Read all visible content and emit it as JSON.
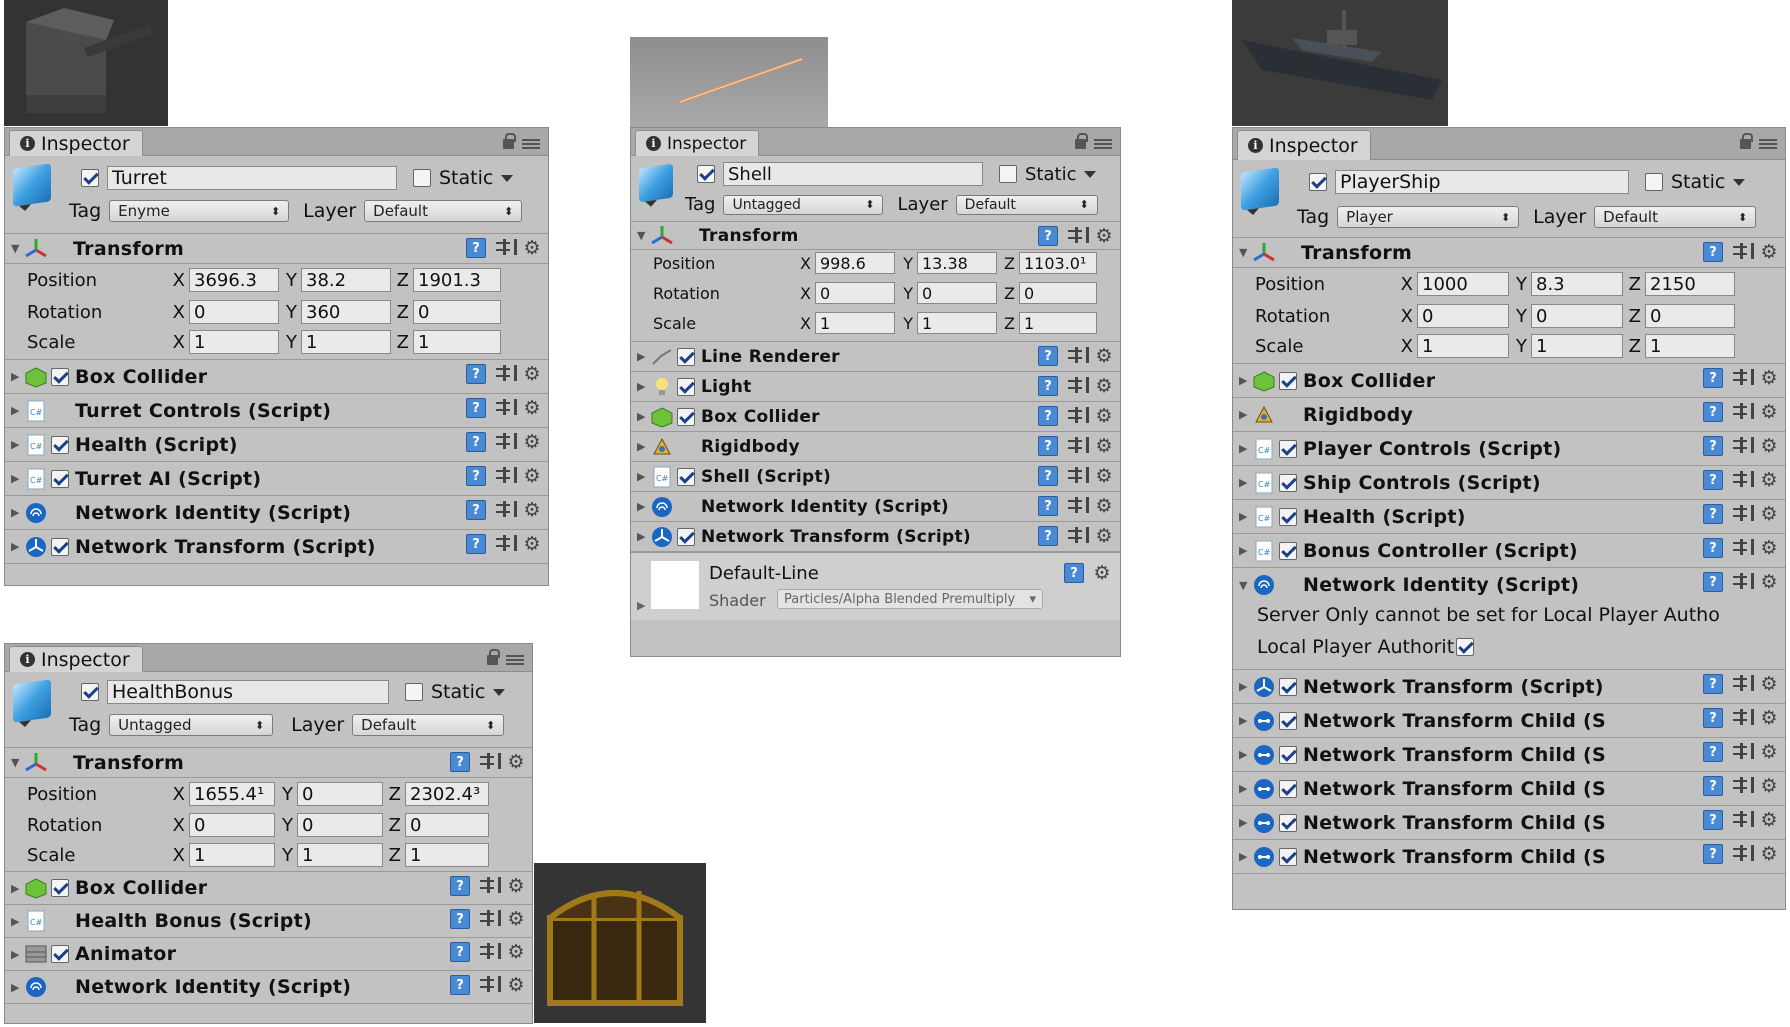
{
  "turret": {
    "tab": "Inspector",
    "name": "Turret",
    "static_label": "Static",
    "tag_label": "Tag",
    "tag": "Enyme",
    "layer_label": "Layer",
    "layer": "Default",
    "transform": "Transform",
    "position_label": "Position",
    "rotation_label": "Rotation",
    "scale_label": "Scale",
    "pos": [
      "3696.3",
      "38.2",
      "1901.3"
    ],
    "rot": [
      "0",
      "360",
      "0"
    ],
    "scale": [
      "1",
      "1",
      "1"
    ],
    "components": [
      "Box Collider",
      "Turret Controls (Script)",
      "Health (Script)",
      "Turret AI (Script)",
      "Network Identity (Script)",
      "Network Transform (Script)"
    ]
  },
  "bonus": {
    "tab": "Inspector",
    "name": "HealthBonus",
    "static_label": "Static",
    "tag_label": "Tag",
    "tag": "Untagged",
    "layer_label": "Layer",
    "layer": "Default",
    "transform": "Transform",
    "position_label": "Position",
    "rotation_label": "Rotation",
    "scale_label": "Scale",
    "pos": [
      "1655.4¹",
      "0",
      "2302.4³"
    ],
    "rot": [
      "0",
      "0",
      "0"
    ],
    "scale": [
      "1",
      "1",
      "1"
    ],
    "components": [
      "Box Collider",
      "Health Bonus (Script)",
      "Animator",
      "Network Identity (Script)"
    ]
  },
  "shell": {
    "tab": "Inspector",
    "name": "Shell",
    "static_label": "Static",
    "tag_label": "Tag",
    "tag": "Untagged",
    "layer_label": "Layer",
    "layer": "Default",
    "transform": "Transform",
    "position_label": "Position",
    "rotation_label": "Rotation",
    "scale_label": "Scale",
    "pos": [
      "998.6",
      "13.38",
      "1103.0¹"
    ],
    "rot": [
      "0",
      "0",
      "0"
    ],
    "scale": [
      "1",
      "1",
      "1"
    ],
    "components": [
      "Line Renderer",
      "Light",
      "Box Collider",
      "Rigidbody",
      "Shell (Script)",
      "Network Identity (Script)",
      "Network Transform (Script)"
    ],
    "material": "Default-Line",
    "shader_label": "Shader",
    "shader": "Particles/Alpha Blended Premultiply"
  },
  "ship": {
    "tab": "Inspector",
    "name": "PlayerShip",
    "static_label": "Static",
    "tag_label": "Tag",
    "tag": "Player",
    "layer_label": "Layer",
    "layer": "Default",
    "transform": "Transform",
    "position_label": "Position",
    "rotation_label": "Rotation",
    "scale_label": "Scale",
    "pos": [
      "1000",
      "8.3",
      "2150"
    ],
    "rot": [
      "0",
      "0",
      "0"
    ],
    "scale": [
      "1",
      "1",
      "1"
    ],
    "components": [
      "Box Collider",
      "Rigidbody",
      "Player Controls (Script)",
      "Ship Controls (Script)",
      "Health (Script)",
      "Bonus Controller (Script)",
      "Network Identity (Script)"
    ],
    "warning": "Server Only cannot be set for Local Player Autho",
    "local_label": "Local Player Authorit",
    "components2": [
      "Network Transform (Script)",
      "Network Transform Child (S",
      "Network Transform Child (S",
      "Network Transform Child (S",
      "Network Transform Child (S",
      "Network Transform Child (S"
    ]
  },
  "axes": [
    "X",
    "Y",
    "Z"
  ],
  "colors": {
    "panel": "#c2c2c2",
    "tab": "#d4d4d4",
    "accent": "#1c3f8a",
    "script_blue": "#1a66c2"
  }
}
